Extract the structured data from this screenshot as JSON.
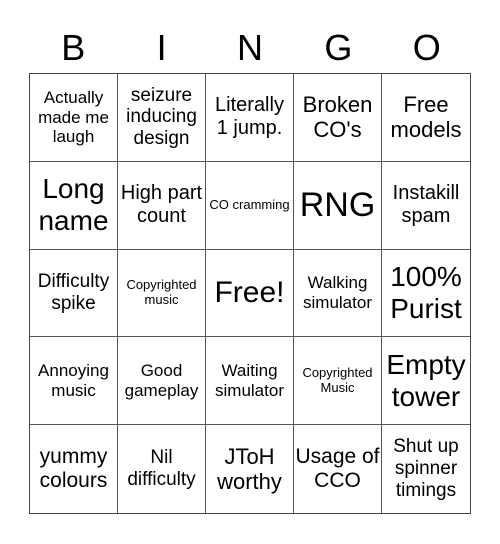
{
  "header": {
    "letters": [
      "B",
      "I",
      "N",
      "G",
      "O"
    ]
  },
  "cells": [
    "Actually made me laugh",
    "seizure inducing design",
    "Literally 1 jump.",
    "Broken CO's",
    "Free models",
    "Long name",
    "High part count",
    "CO cramming",
    "RNG",
    "Instakill spam",
    "Difficulty spike",
    "Copyrighted music",
    "Free!",
    "Walking simulator",
    "100% Purist",
    "Annoying music",
    "Good gameplay",
    "Waiting simulator",
    "Copyrighted Music",
    "Empty tower",
    "yummy colours",
    "Nil difficulty",
    "JToH worthy",
    "Usage of CCO",
    "Shut up spinner timings"
  ]
}
